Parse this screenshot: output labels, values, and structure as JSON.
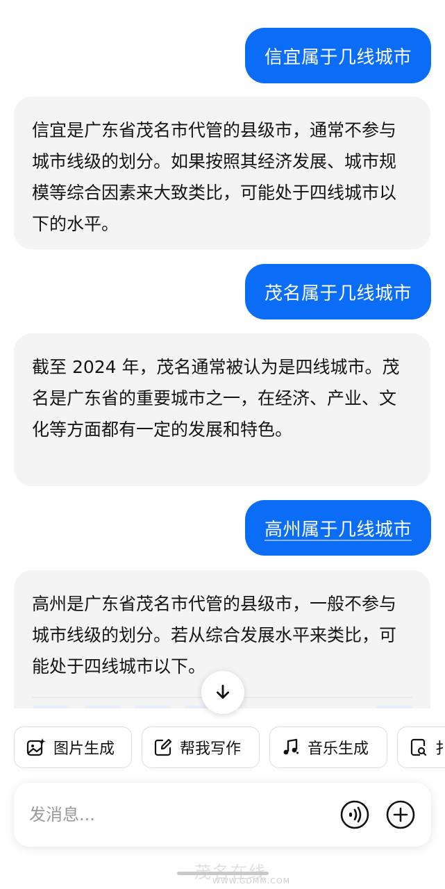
{
  "conversation": [
    {
      "role": "user",
      "text": "信宜属于几线城市"
    },
    {
      "role": "assistant",
      "text": "信宜是广东省茂名市代管的县级市，通常不参与城市线级的划分。如果按照其经济发展、城市规模等综合因素来大致类比，可能处于四线城市以下的水平。"
    },
    {
      "role": "user",
      "text": "茂名属于几线城市"
    },
    {
      "role": "assistant",
      "text": "截至 2024 年，茂名通常被认为是四线城市。茂名是广东省的重要城市之一，在经济、产业、文化等方面都有一定的发展和特色。"
    },
    {
      "role": "user",
      "text": "高州属于几线城市"
    },
    {
      "role": "assistant",
      "text": "高州是广东省茂名市代管的县级市，一般不参与城市线级的划分。若从综合发展水平来类比，可能处于四线城市以下。"
    }
  ],
  "tools": [
    {
      "label": "图片生成",
      "icon": "image-sparkle-icon"
    },
    {
      "label": "帮我写作",
      "icon": "edit-icon"
    },
    {
      "label": "音乐生成",
      "icon": "music-note-icon"
    },
    {
      "label": "扌",
      "icon": "doc-search-icon"
    }
  ],
  "composer": {
    "placeholder": "发消息...",
    "voice_icon": "voice-call-icon",
    "add_icon": "plus-circle-icon"
  },
  "scroll_down_icon": "arrow-down-icon",
  "watermark": {
    "text": "茂名在线",
    "url": "WWW.GDMM.COM"
  },
  "colors": {
    "user_bubble": "#0b6cf5",
    "bot_bubble": "#f4f4f5",
    "accent": "#0b6cf5"
  }
}
